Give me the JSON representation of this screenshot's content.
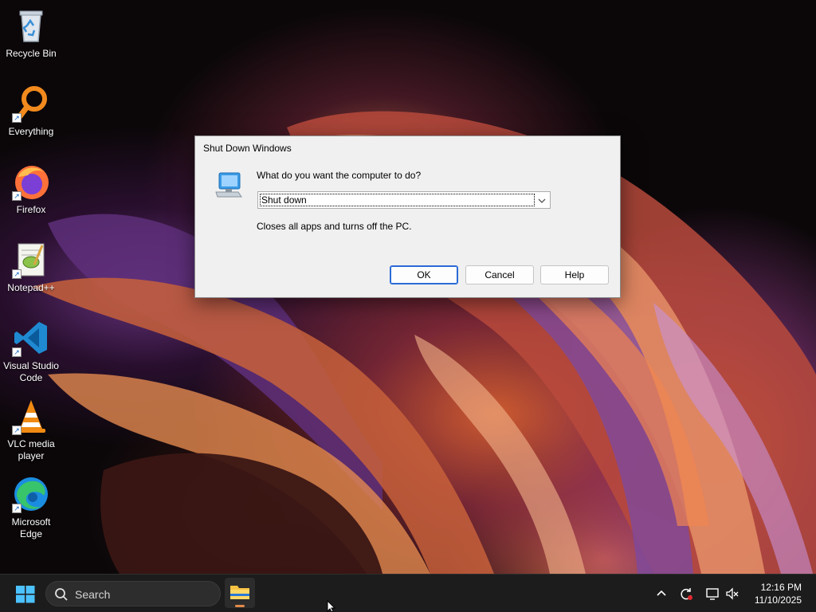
{
  "desktop": {
    "icons": [
      {
        "label": "Recycle Bin"
      },
      {
        "label": "Everything"
      },
      {
        "label": "Firefox"
      },
      {
        "label": "Notepad++"
      },
      {
        "label": "Visual Studio Code"
      },
      {
        "label": "VLC media player"
      },
      {
        "label": "Microsoft Edge"
      }
    ]
  },
  "dialog": {
    "title": "Shut Down Windows",
    "question": "What do you want the computer to do?",
    "selected_option": "Shut down",
    "description": "Closes all apps and turns off the PC.",
    "ok_label": "OK",
    "cancel_label": "Cancel",
    "help_label": "Help"
  },
  "taskbar": {
    "search_placeholder": "Search",
    "time": "12:16 PM",
    "date": "11/10/2025",
    "tray_icons": [
      "chevron-up-icon",
      "sync-icon",
      "display-icon",
      "volume-muted-icon"
    ]
  },
  "colors": {
    "accent": "#2b6bd6",
    "taskbar_bg": "#1c1c1c",
    "dialog_bg": "#f0f0f0"
  }
}
